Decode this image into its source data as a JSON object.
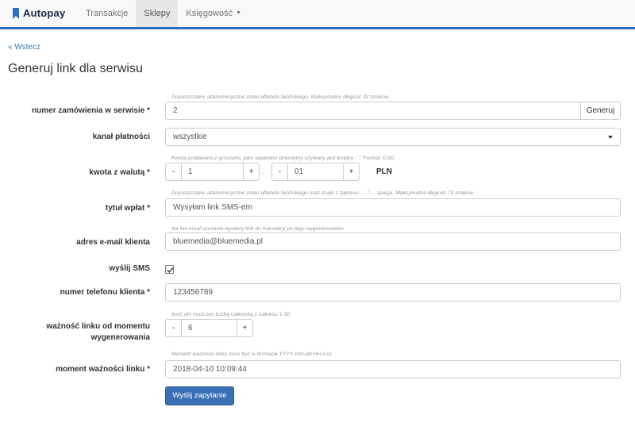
{
  "brand": {
    "name": "Autopay"
  },
  "nav": {
    "items": [
      {
        "label": "Transakcje"
      },
      {
        "label": "Sklepy"
      },
      {
        "label": "Księgowość"
      }
    ]
  },
  "back_link": "« Wstecz",
  "title": "Generuj link dla serwisu",
  "form": {
    "order_number": {
      "label": "numer zamówienia w serwisie *",
      "hint": "Dopuszczalne alfanumeryczne znaki alfabetu łacińskiego, Maksymalna długość 32 znaków",
      "value": "2",
      "generate_label": "Generuj"
    },
    "payment_channel": {
      "label": "kanał płatności",
      "value": "wszystkie"
    },
    "amount": {
      "label": "kwota z walutą *",
      "hint": "Kwota podawana z groszami, jako separator dziesiętny używany jest kropka - '.' Format: 0.00;",
      "whole": "1",
      "separator": ".",
      "cents": "01",
      "currency": "PLN",
      "minus": "-",
      "plus": "+"
    },
    "title": {
      "label": "tytuł wpłat *",
      "hint": "Dopuszczalne alfanumeryczne znaki alfabetu łacińskiego oraz znaki z zakresu: . : / - , spacja. Maksymalna długość 79 znaków",
      "value": "Wysyłam link SMS-em"
    },
    "email": {
      "label": "adres e-mail klienta",
      "hint": "Na ten email zostanie wysłany link do transakcji po jego wygenerowaniu",
      "value": "bluemedia@bluemedia.pl"
    },
    "send_sms": {
      "label": "wyślij SMS",
      "checked": true
    },
    "phone": {
      "label": "numer telefonu klienta *",
      "value": "123456789"
    },
    "validity": {
      "label_line1": "ważność linku od momentu",
      "label_line2": "wygenerowania",
      "hint": "Ilość dni musi być liczbą całkowitą z zakresu 1-30",
      "value": "6",
      "minus": "-",
      "plus": "+"
    },
    "expiry": {
      "label": "moment ważności linku *",
      "hint": "Moment ważności linku musi być w formacie YYYY-mm-dd HH:ii:ss",
      "value": "2018-04-10 10:09:44"
    },
    "submit_label": "Wyślij zapytanie"
  },
  "colors": {
    "accent": "#2f6bbf",
    "link": "#337ab7",
    "submit": "#3a70b5"
  }
}
